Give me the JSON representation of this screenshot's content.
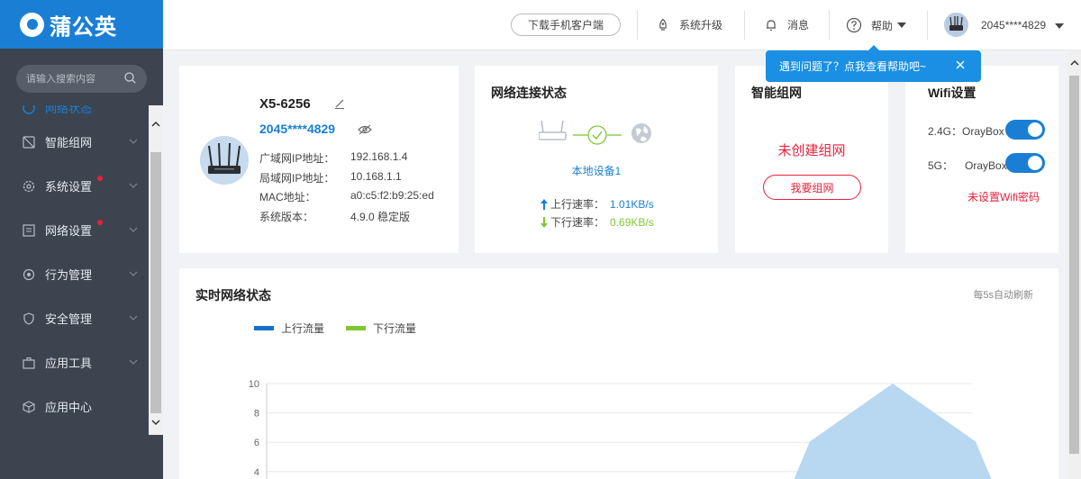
{
  "app": {
    "logo_text": "蒲公英"
  },
  "search": {
    "placeholder": "请输入搜索内容"
  },
  "sidebar": {
    "items": [
      {
        "label": "网络状态",
        "icon": "status-icon"
      },
      {
        "label": "智能组网",
        "icon": "network-icon"
      },
      {
        "label": "系统设置",
        "icon": "gear-icon",
        "badge": true
      },
      {
        "label": "网络设置",
        "icon": "list-icon",
        "badge": true
      },
      {
        "label": "行为管理",
        "icon": "target-icon"
      },
      {
        "label": "安全管理",
        "icon": "shield-icon"
      },
      {
        "label": "应用工具",
        "icon": "toolbox-icon"
      },
      {
        "label": "应用中心",
        "icon": "cube-icon"
      }
    ]
  },
  "header": {
    "download_label": "下载手机客户端",
    "upgrade_label": "系统升级",
    "message_label": "消息",
    "help_label": "帮助",
    "user_name": "2045****4829"
  },
  "tooltip": {
    "text": "遇到问题了？点我查看帮助吧~"
  },
  "device": {
    "name": "X5-6256",
    "sn": "2045****4829",
    "wan_ip_label": "广域网IP地址：",
    "wan_ip": "192.168.1.4",
    "lan_ip_label": "局域网IP地址：",
    "lan_ip": "10.168.1.1",
    "mac_label": "MAC地址：",
    "mac": "a0:c5:f2:b9:25:ed",
    "version_label": "系统版本：",
    "version": "4.9.0 稳定版"
  },
  "network": {
    "title": "网络连接状态",
    "local_device": "本地设备1",
    "up_label": "上行速率：",
    "up_value": "1.01KB/s",
    "down_label": "下行速率：",
    "down_value": "0.69KB/s"
  },
  "group": {
    "title": "智能组网",
    "status": "未创建组网",
    "button": "我要组网"
  },
  "wifi": {
    "title": "Wifi设置",
    "band_24_label": "2.4G：",
    "band_24_ssid": "OrayBox",
    "band_5_label": "5G：",
    "band_5_ssid": "OrayBox",
    "band_24_on": true,
    "band_5_on": true,
    "warning": "未设置Wifi密码"
  },
  "realtime": {
    "title": "实时网络状态",
    "refresh_note": "每5s自动刷新"
  },
  "colors": {
    "brand": "#1a7fd4",
    "sidebar_bg": "#3c4450",
    "alert": "#e8213d",
    "downlink": "#7dc733",
    "up_series": "#1a6fc7",
    "area_fill": "#b8d7f0"
  },
  "chart_data": {
    "type": "area",
    "series": [
      {
        "name": "上行流量",
        "color": "#1a6fc7"
      },
      {
        "name": "下行流量",
        "color": "#7dc733"
      }
    ],
    "ylim": [
      0,
      10
    ],
    "yticks": [
      "10",
      "8",
      "6",
      "4"
    ],
    "grid": true,
    "legend": "top-left",
    "peak": {
      "y": 10
    }
  }
}
